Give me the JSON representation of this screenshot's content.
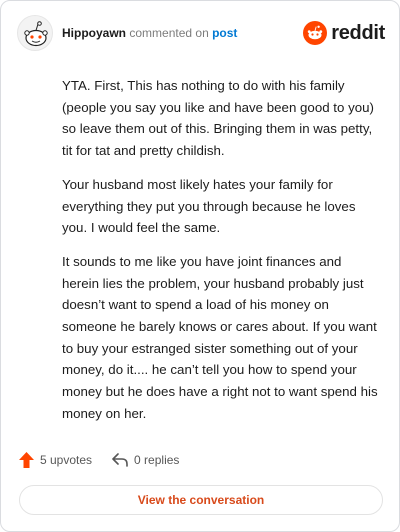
{
  "header": {
    "username": "Hippoyawn",
    "verb": "commented on",
    "post_link": "post",
    "brand": "reddit"
  },
  "comment": {
    "paragraphs": [
      "YTA. First, This has nothing to do with his family (people you say you like and have been good to you) so leave them out of this. Bringing them in was petty, tit for tat and pretty childish.",
      "Your husband most likely hates your family for everything they put you through because he loves you. I would feel the same.",
      "It sounds to me like you have joint finances and herein lies the problem, your husband probably just doesn’t want to spend a load of his money on someone he barely knows or cares about. If you want to buy your estranged sister something out of your money, do it.... he can’t tell you how to spend your money but he does have a right not to want spend his money on her."
    ]
  },
  "actions": {
    "upvotes": "5 upvotes",
    "replies": "0 replies"
  },
  "footer": {
    "view_label": "View the conversation"
  },
  "colors": {
    "accent": "#ff4500",
    "link": "#0079d3",
    "button_text": "#d84a1b"
  },
  "icons": [
    "snoo-avatar-icon",
    "reddit-logo-icon",
    "upvote-arrow-icon",
    "reply-arrow-icon"
  ]
}
